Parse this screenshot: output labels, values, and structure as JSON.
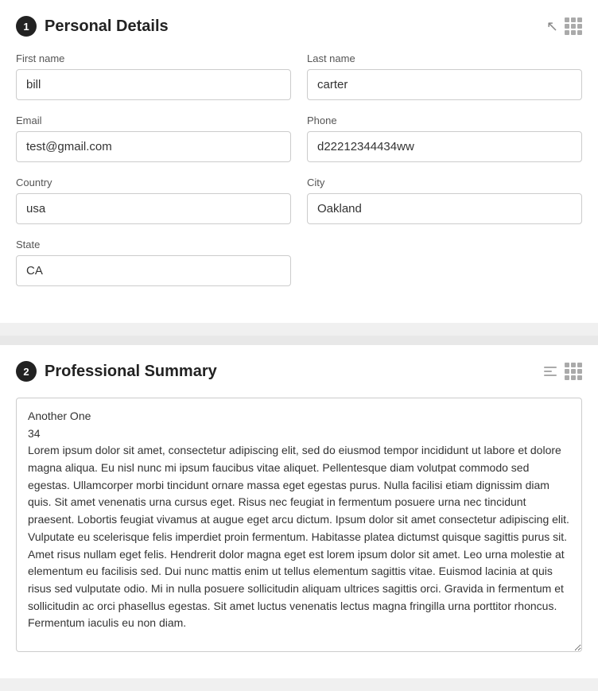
{
  "sections": [
    {
      "id": "personal-details",
      "number": "1",
      "title": "Personal Details",
      "fields": [
        {
          "row": [
            {
              "id": "first-name",
              "label": "First name",
              "value": "bill"
            },
            {
              "id": "last-name",
              "label": "Last name",
              "value": "carter"
            }
          ]
        },
        {
          "row": [
            {
              "id": "email",
              "label": "Email",
              "value": "test@gmail.com"
            },
            {
              "id": "phone",
              "label": "Phone",
              "value": "d22212344434ww"
            }
          ]
        },
        {
          "row": [
            {
              "id": "country",
              "label": "Country",
              "value": "usa"
            },
            {
              "id": "city",
              "label": "City",
              "value": "Oakland"
            }
          ]
        },
        {
          "row": [
            {
              "id": "state",
              "label": "State",
              "value": "CA"
            }
          ]
        }
      ]
    },
    {
      "id": "professional-summary",
      "number": "2",
      "title": "Professional Summary",
      "textarea": {
        "id": "summary",
        "value": "Another One\n34\nLorem ipsum dolor sit amet, consectetur adipiscing elit, sed do eiusmod tempor incididunt ut labore et dolore magna aliqua. Eu nisl nunc mi ipsum faucibus vitae aliquet. Pellentesque diam volutpat commodo sed egestas. Ullamcorper morbi tincidunt ornare massa eget egestas purus. Nulla facilisi etiam dignissim diam quis. Sit amet venenatis urna cursus eget. Risus nec feugiat in fermentum posuere urna nec tincidunt praesent. Lobortis feugiat vivamus at augue eget arcu dictum. Ipsum dolor sit amet consectetur adipiscing elit. Vulputate eu scelerisque felis imperdiet proin fermentum. Habitasse platea dictumst quisque sagittis purus sit. Amet risus nullam eget felis. Hendrerit dolor magna eget est lorem ipsum dolor sit amet. Leo urna molestie at elementum eu facilisis sed. Dui nunc mattis enim ut tellus elementum sagittis vitae. Euismod lacinia at quis risus sed vulputate odio. Mi in nulla posuere sollicitudin aliquam ultrices sagittis orci. Gravida in fermentum et sollicitudin ac orci phasellus egestas. Sit amet luctus venenatis lectus magna fringilla urna porttitor rhoncus. Fermentum iaculis eu non diam."
      }
    }
  ],
  "icons": {
    "cursor_icon": "⊹"
  }
}
